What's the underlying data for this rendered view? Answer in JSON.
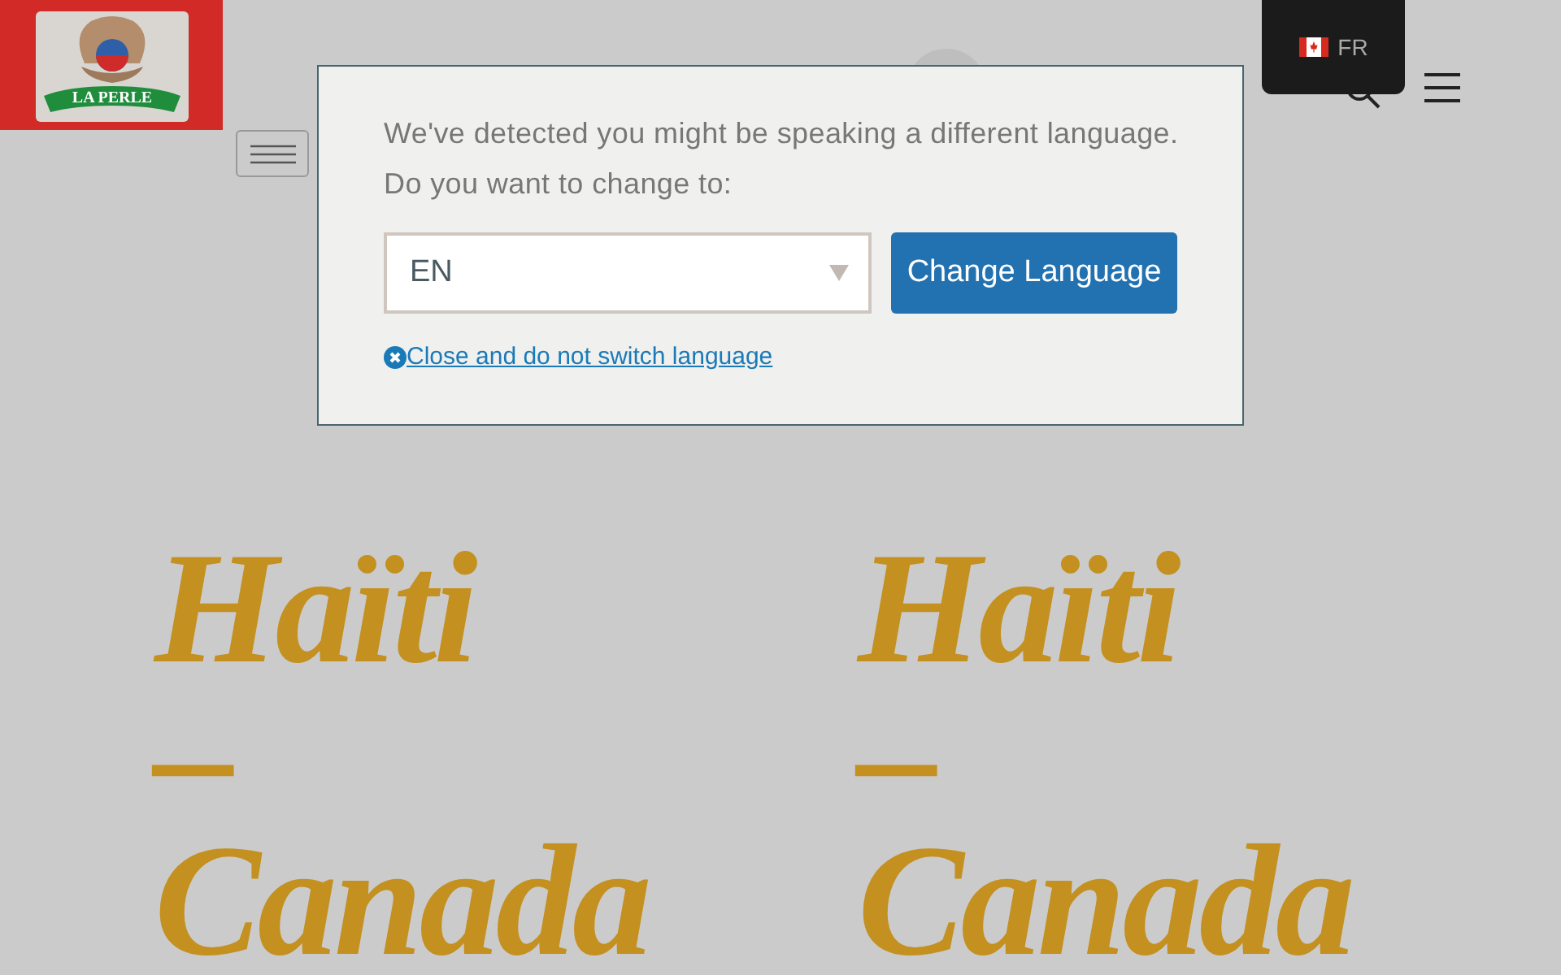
{
  "header": {
    "logo_text": "LA PERLE"
  },
  "language_switcher": {
    "label": "FR"
  },
  "headlines": [
    {
      "lines": [
        "Haïti",
        "–",
        "Canada"
      ]
    },
    {
      "lines": [
        "Haïti",
        "–",
        "Canada"
      ]
    }
  ],
  "language_dialog": {
    "message": [
      "We've detected you might be speaking a different language.",
      "Do you want to change to:"
    ],
    "select_value": "EN",
    "button": "Change Language",
    "close_link": "Close and do not switch language"
  }
}
